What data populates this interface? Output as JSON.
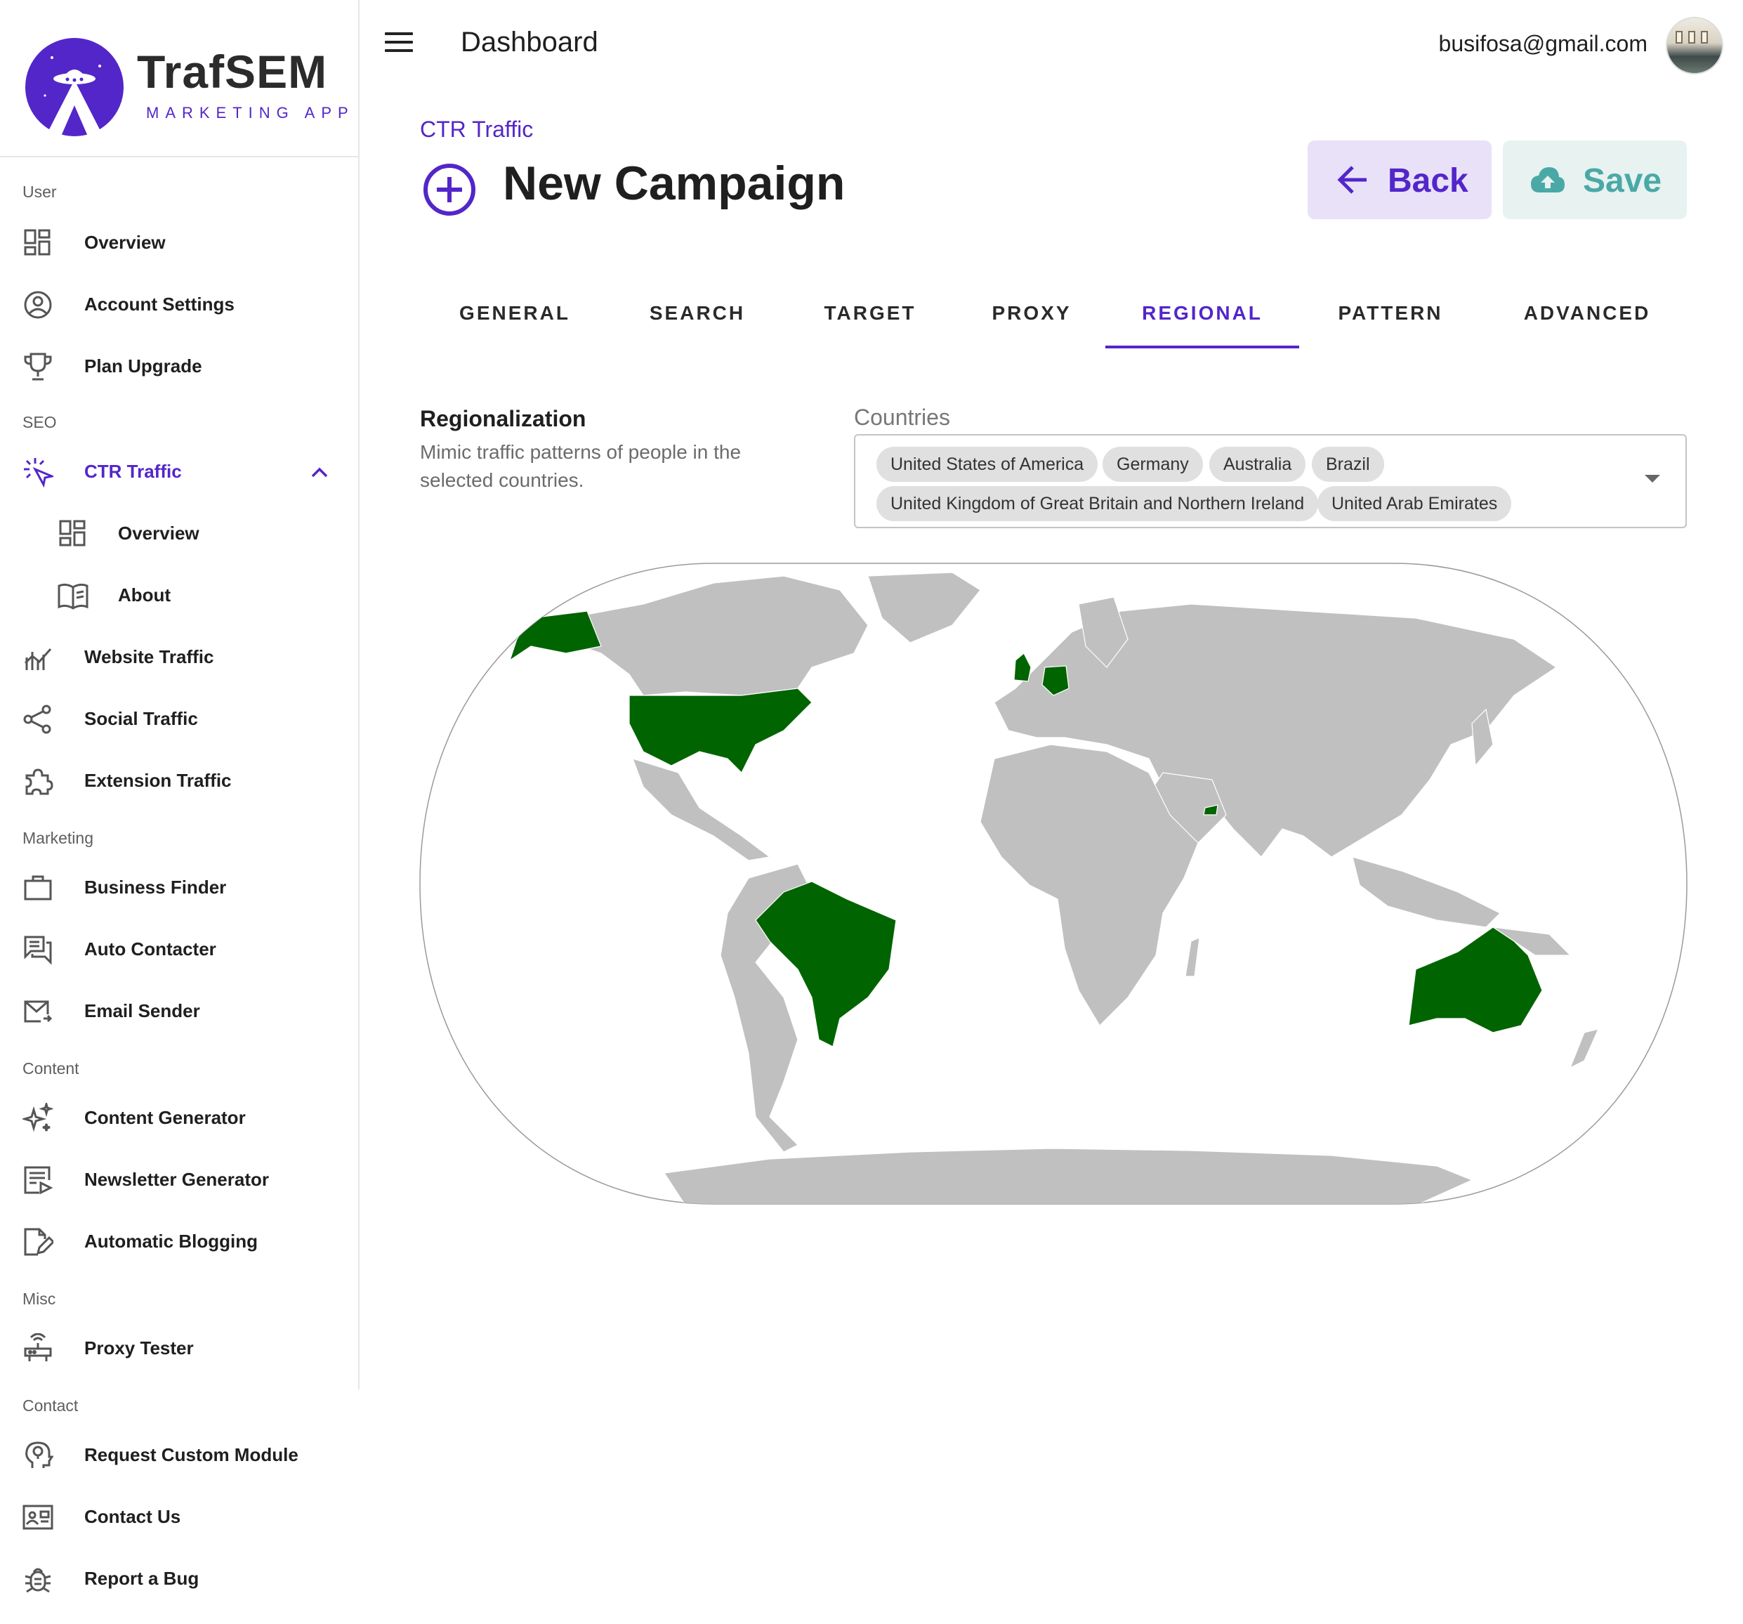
{
  "brand": {
    "name": "TrafSEM",
    "tagline": "MARKETING APP"
  },
  "topbar": {
    "title": "Dashboard",
    "user_email": "busifosa@gmail.com"
  },
  "sidebar": {
    "sections": {
      "user": "User",
      "seo": "SEO",
      "marketing": "Marketing",
      "content": "Content",
      "misc": "Misc",
      "contact": "Contact"
    },
    "items": {
      "overview": "Overview",
      "account_settings": "Account Settings",
      "plan_upgrade": "Plan Upgrade",
      "ctr_traffic": "CTR Traffic",
      "ctr_overview": "Overview",
      "ctr_about": "About",
      "website_traffic": "Website Traffic",
      "social_traffic": "Social Traffic",
      "extension_traffic": "Extension Traffic",
      "business_finder": "Business Finder",
      "auto_contacter": "Auto Contacter",
      "email_sender": "Email Sender",
      "content_generator": "Content Generator",
      "newsletter_generator": "Newsletter Generator",
      "automatic_blogging": "Automatic Blogging",
      "proxy_tester": "Proxy Tester",
      "request_custom_module": "Request Custom Module",
      "contact_us": "Contact Us",
      "report_bug": "Report a Bug"
    },
    "active_item": "CTR Traffic"
  },
  "page": {
    "breadcrumb": "CTR Traffic",
    "title": "New Campaign",
    "back_label": "Back",
    "save_label": "Save"
  },
  "tabs": [
    "GENERAL",
    "SEARCH",
    "TARGET",
    "PROXY",
    "REGIONAL",
    "PATTERN",
    "ADVANCED"
  ],
  "active_tab": "REGIONAL",
  "regional": {
    "heading": "Regionalization",
    "description": "Mimic traffic patterns of people in the selected countries.",
    "countries_label": "Countries",
    "selected_countries": [
      "United States of America",
      "Germany",
      "Australia",
      "Brazil",
      "United Kingdom of Great Britain and Northern Ireland",
      "United Arab Emirates"
    ]
  },
  "colors": {
    "accent": "#5326c9",
    "save_accent": "#4aa9a6",
    "map_selected": "#006400",
    "map_land": "#c0c0c0"
  }
}
